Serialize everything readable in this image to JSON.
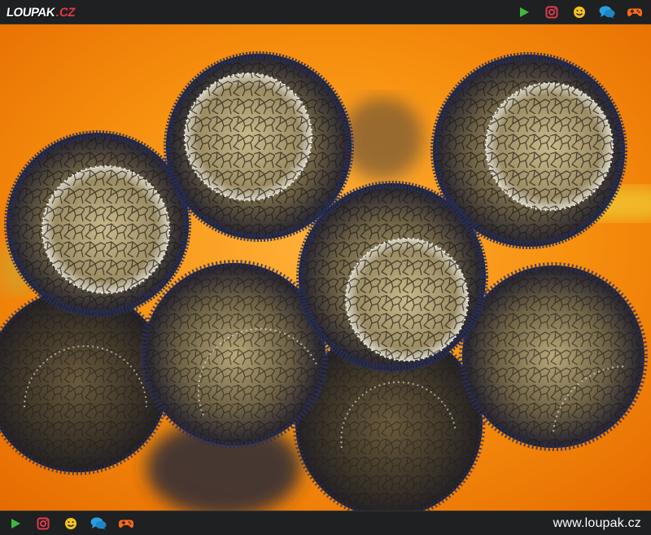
{
  "header": {
    "logo_main": "LOUPAK",
    "logo_tld": "CZ",
    "icons": [
      "play-icon",
      "instagram-icon",
      "smiley-icon",
      "chat-icon",
      "gamepad-icon"
    ]
  },
  "photo": {
    "kind": "macro photograph of dark textured spheres on orange background"
  },
  "footer": {
    "url": "www.loupak.cz",
    "icons": [
      "play-icon",
      "instagram-icon",
      "smiley-icon",
      "chat-icon",
      "gamepad-icon"
    ]
  },
  "colors": {
    "bar": "#1e2022",
    "play": "#3fb93f",
    "instagram": "#e23a4a",
    "smiley": "#f4c21a",
    "chat": "#2a9fe0",
    "gamepad": "#ff6a1a",
    "background_orange": "#f5820a"
  }
}
